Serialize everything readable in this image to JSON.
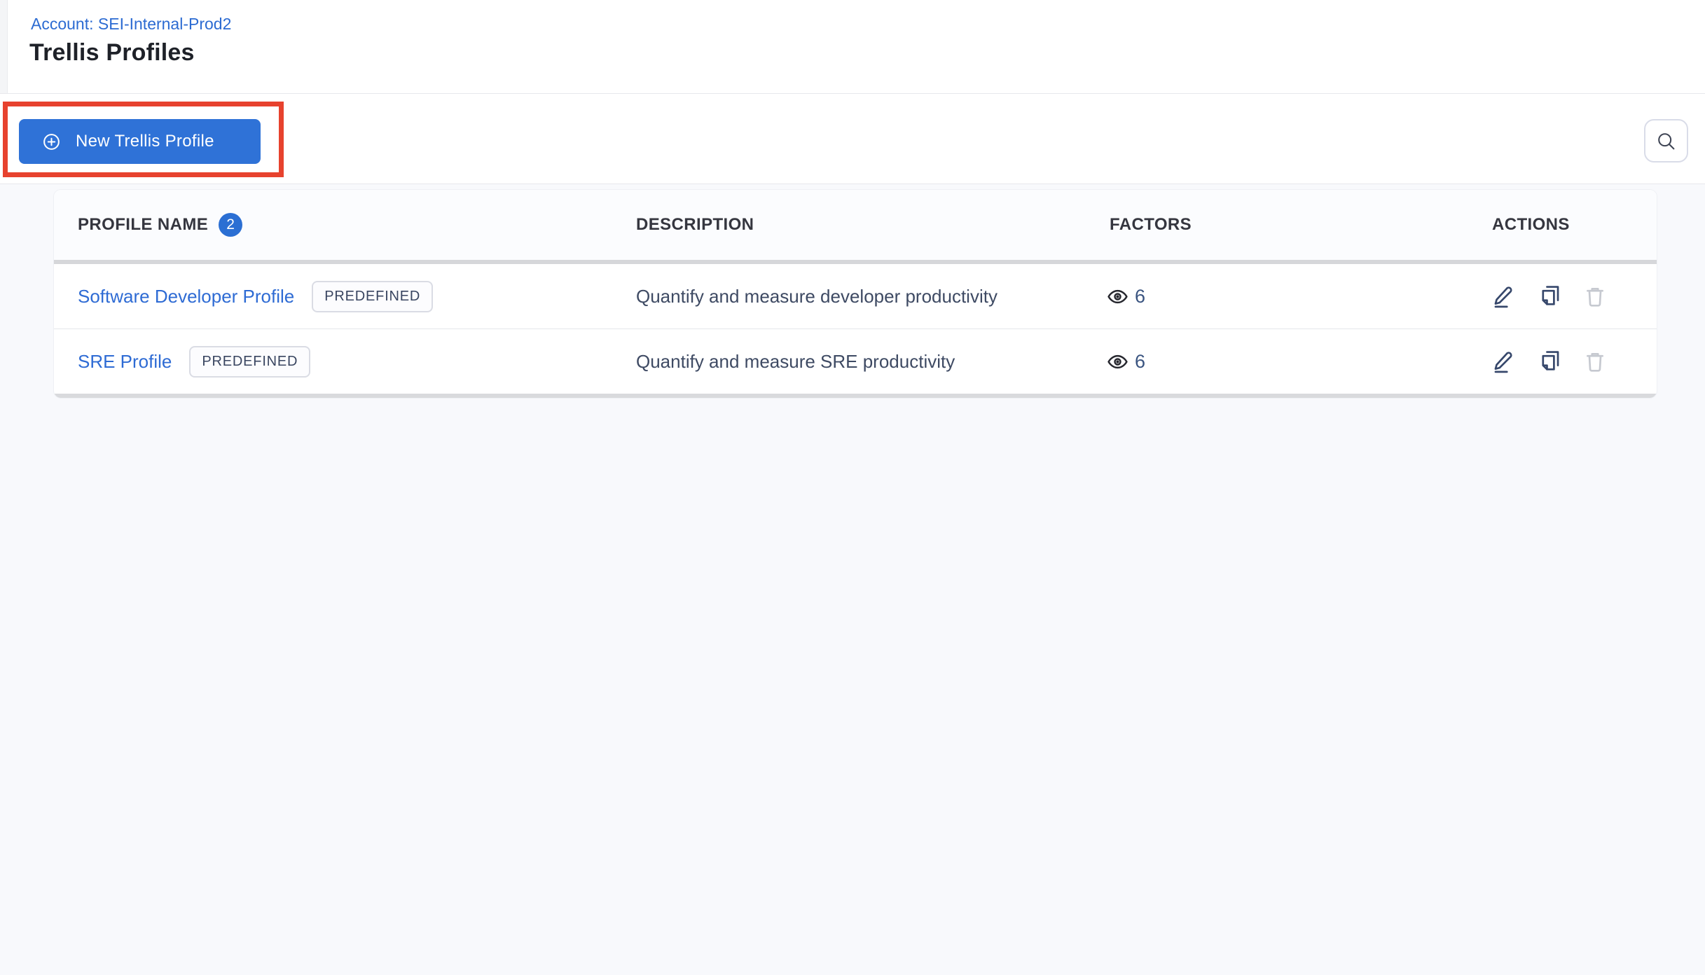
{
  "header": {
    "account": "Account: SEI-Internal-Prod2",
    "title": "Trellis Profiles"
  },
  "toolbar": {
    "new_profile_label": "New Trellis Profile"
  },
  "table": {
    "columns": [
      "PROFILE NAME",
      "DESCRIPTION",
      "FACTORS",
      "ACTIONS"
    ],
    "profile_count": "2",
    "rows": [
      {
        "name": "Software Developer Profile",
        "tag": "PREDEFINED",
        "description": "Quantify and measure developer productivity",
        "factors": "6"
      },
      {
        "name": "SRE Profile",
        "tag": "PREDEFINED",
        "description": "Quantify and measure SRE productivity",
        "factors": "6"
      }
    ]
  },
  "icons": {
    "new_profile": "plus-circle-icon",
    "search": "search-icon",
    "factors": "eye-icon",
    "edit": "pencil-icon",
    "clone": "copy-icon",
    "delete": "trash-icon"
  },
  "colors": {
    "primary_button_blue": "#2f72d7",
    "link_blue": "#2e6bd4",
    "count_badge_blue": "#2b6fd3",
    "annotation_red": "#e7422e",
    "page_background": "#f8f9fc"
  }
}
